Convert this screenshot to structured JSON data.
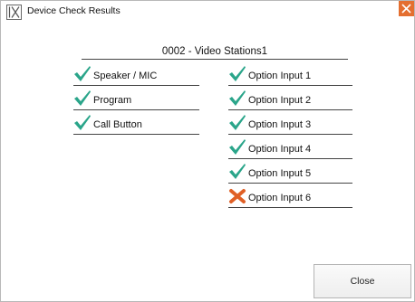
{
  "window": {
    "title": "Device Check Results",
    "logo_icon": "ix-logo-icon",
    "close_icon": "close-x-icon",
    "close_color": "#e46f30"
  },
  "station": {
    "title": "0002 - Video Stations1"
  },
  "colors": {
    "pass": "#2aa58a",
    "fail": "#e06026"
  },
  "checks_left": [
    {
      "label": "Speaker / MIC",
      "status": "pass"
    },
    {
      "label": "Program",
      "status": "pass"
    },
    {
      "label": "Call Button",
      "status": "pass"
    }
  ],
  "checks_right": [
    {
      "label": "Option Input 1",
      "status": "pass"
    },
    {
      "label": "Option Input 2",
      "status": "pass"
    },
    {
      "label": "Option Input 3",
      "status": "pass"
    },
    {
      "label": "Option Input 4",
      "status": "pass"
    },
    {
      "label": "Option Input 5",
      "status": "pass"
    },
    {
      "label": "Option Input 6",
      "status": "fail"
    }
  ],
  "buttons": {
    "close_label": "Close"
  }
}
